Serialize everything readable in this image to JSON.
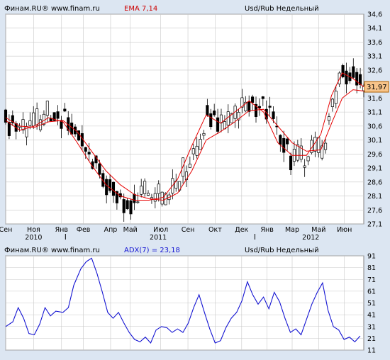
{
  "colors": {
    "background": "#dce6f2",
    "plot_bg": "#ffffff",
    "grid": "#c8c8c8",
    "candle": "#000000",
    "ema": "#e60000",
    "adx": "#1414d2",
    "last_price_box": "#f7c48a"
  },
  "chart_data": [
    {
      "type": "candlestick",
      "header": {
        "source": "Финам.RU®  www.finam.ru",
        "indicator": "EMA 7,14",
        "instrument": "Usd/Rub Недельный"
      },
      "last_price_label": "31,97",
      "ylim": [
        27.1,
        34.6
      ],
      "y_ticks": [
        "27,1",
        "27,6",
        "28,1",
        "28,6",
        "29,1",
        "29,6",
        "30,1",
        "30,6",
        "31,1",
        "31,6",
        "32,1",
        "32,6",
        "33,1",
        "33,6",
        "34,1",
        "34,6"
      ],
      "x_domain": [
        0,
        100
      ],
      "x_ticks": [
        {
          "label": "Сен",
          "x": 0
        },
        {
          "label": "Ноя",
          "x": 7.8
        },
        {
          "label": "Янв",
          "x": 15.6
        },
        {
          "label": "Фев",
          "x": 21.7
        },
        {
          "label": "Апр",
          "x": 29.3
        },
        {
          "label": "Май",
          "x": 34.8
        },
        {
          "label": "Июл",
          "x": 43.3
        },
        {
          "label": "Сен",
          "x": 50.9
        },
        {
          "label": "Окт",
          "x": 58.5
        },
        {
          "label": "Дек",
          "x": 65.9
        },
        {
          "label": "Янв",
          "x": 73.0
        },
        {
          "label": "Мар",
          "x": 80.0
        },
        {
          "label": "Май",
          "x": 87.4
        },
        {
          "label": "Июн",
          "x": 94.6
        }
      ],
      "year_ticks": [
        {
          "label": "2010",
          "x": 7.8
        },
        {
          "label": "2011",
          "x": 42.6
        },
        {
          "label": "2012",
          "x": 85.2
        }
      ],
      "year_markers": [
        16.7,
        69.6
      ],
      "series": [
        {
          "name": "EMA 7",
          "values": [
            [
              0,
              30.8
            ],
            [
              4,
              30.45
            ],
            [
              8,
              30.6
            ],
            [
              12,
              30.9
            ],
            [
              16,
              30.75
            ],
            [
              20,
              30.0
            ],
            [
              24,
              29.2
            ],
            [
              28,
              28.5
            ],
            [
              32,
              28.1
            ],
            [
              36,
              27.95
            ],
            [
              40,
              27.95
            ],
            [
              44,
              28.05
            ],
            [
              48,
              28.7
            ],
            [
              52,
              29.9
            ],
            [
              56,
              31.0
            ],
            [
              60,
              30.7
            ],
            [
              64,
              31.1
            ],
            [
              68,
              31.5
            ],
            [
              72,
              31.1
            ],
            [
              76,
              30.0
            ],
            [
              80,
              29.55
            ],
            [
              84,
              29.55
            ],
            [
              88,
              30.3
            ],
            [
              91,
              31.7
            ],
            [
              94,
              32.5
            ],
            [
              97,
              32.3
            ],
            [
              100,
              32.0
            ]
          ]
        },
        {
          "name": "EMA 14",
          "values": [
            [
              0,
              30.9
            ],
            [
              4,
              30.6
            ],
            [
              8,
              30.55
            ],
            [
              12,
              30.75
            ],
            [
              16,
              30.8
            ],
            [
              20,
              30.4
            ],
            [
              24,
              29.7
            ],
            [
              28,
              29.0
            ],
            [
              32,
              28.5
            ],
            [
              36,
              28.15
            ],
            [
              40,
              28.0
            ],
            [
              44,
              27.95
            ],
            [
              48,
              28.2
            ],
            [
              52,
              29.0
            ],
            [
              56,
              30.1
            ],
            [
              60,
              30.4
            ],
            [
              64,
              30.75
            ],
            [
              68,
              31.15
            ],
            [
              72,
              31.2
            ],
            [
              76,
              30.6
            ],
            [
              80,
              30.0
            ],
            [
              84,
              29.7
            ],
            [
              88,
              29.75
            ],
            [
              91,
              30.7
            ],
            [
              94,
              31.6
            ],
            [
              97,
              31.9
            ],
            [
              100,
              31.85
            ]
          ]
        }
      ]
    },
    {
      "type": "line",
      "header": {
        "source": "Финам.RU®  www.finam.ru",
        "indicator": "ADX(7) = 23,18",
        "instrument": "Usd/Rub Недельный"
      },
      "ylim": [
        11,
        91
      ],
      "y_ticks": [
        "11",
        "21",
        "31",
        "41",
        "51",
        "61",
        "71",
        "81",
        "91"
      ],
      "series": [
        {
          "name": "ADX(7)",
          "values": [
            [
              0,
              31
            ],
            [
              2,
              35
            ],
            [
              3.5,
              47
            ],
            [
              5,
              38
            ],
            [
              6.5,
              25
            ],
            [
              8,
              24
            ],
            [
              9.5,
              33
            ],
            [
              11,
              47
            ],
            [
              12.5,
              40
            ],
            [
              14,
              44
            ],
            [
              16,
              43
            ],
            [
              17.5,
              47
            ],
            [
              19,
              66
            ],
            [
              21,
              80
            ],
            [
              22.5,
              86
            ],
            [
              24,
              89
            ],
            [
              25.5,
              76
            ],
            [
              27,
              60
            ],
            [
              28.5,
              43
            ],
            [
              30,
              38
            ],
            [
              31.5,
              43
            ],
            [
              33,
              34
            ],
            [
              34.5,
              26
            ],
            [
              36,
              20
            ],
            [
              37.5,
              18
            ],
            [
              39,
              22
            ],
            [
              40.5,
              17
            ],
            [
              42,
              28
            ],
            [
              43.5,
              31
            ],
            [
              45,
              30
            ],
            [
              46.5,
              26
            ],
            [
              48,
              29
            ],
            [
              49.5,
              26
            ],
            [
              51,
              34
            ],
            [
              52.5,
              47
            ],
            [
              54,
              58
            ],
            [
              55.5,
              43
            ],
            [
              57,
              29
            ],
            [
              58.5,
              17
            ],
            [
              60,
              19
            ],
            [
              61.5,
              30
            ],
            [
              63,
              38
            ],
            [
              64.5,
              43
            ],
            [
              66,
              53
            ],
            [
              67.5,
              69
            ],
            [
              69,
              58
            ],
            [
              70.5,
              50
            ],
            [
              72,
              56
            ],
            [
              73.5,
              46
            ],
            [
              75,
              60
            ],
            [
              76.5,
              52
            ],
            [
              78,
              38
            ],
            [
              79.5,
              26
            ],
            [
              81,
              29
            ],
            [
              82.5,
              24
            ],
            [
              84,
              37
            ],
            [
              85.5,
              50
            ],
            [
              87,
              60
            ],
            [
              88.5,
              68
            ],
            [
              90,
              45
            ],
            [
              91.5,
              31
            ],
            [
              93,
              28
            ],
            [
              94.5,
              20
            ],
            [
              96,
              22
            ],
            [
              97.5,
              18
            ],
            [
              99,
              23
            ]
          ]
        }
      ]
    }
  ]
}
